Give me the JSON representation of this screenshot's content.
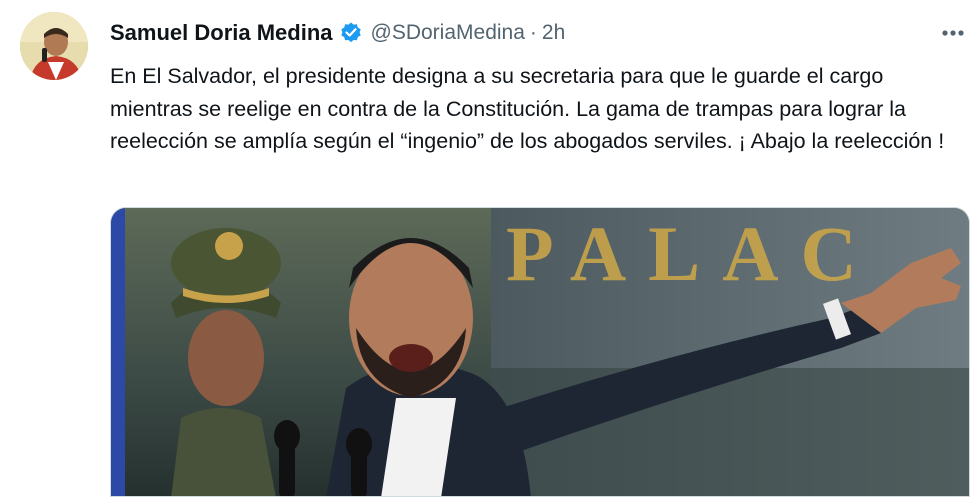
{
  "tweet": {
    "author_name": "Samuel Doria Medina",
    "handle": "@SDoriaMedina",
    "separator": "·",
    "timestamp": "2h",
    "text": "En El Salvador, el presidente designa a su secretaria para que le guarde el cargo mientras se reelige en contra de la Constitución. La gama de trampas para lograr la reelección se amplía según el “ingenio” de los abogados serviles. ¡ Abajo la reelección !",
    "verified": true,
    "icons": {
      "verified": "verified-badge-icon",
      "more": "more-options-icon"
    },
    "colors": {
      "verified": "#1d9bf0",
      "secondary_text": "#536471",
      "primary_text": "#0f1419"
    }
  },
  "media": {
    "background_text": "PALAC"
  }
}
